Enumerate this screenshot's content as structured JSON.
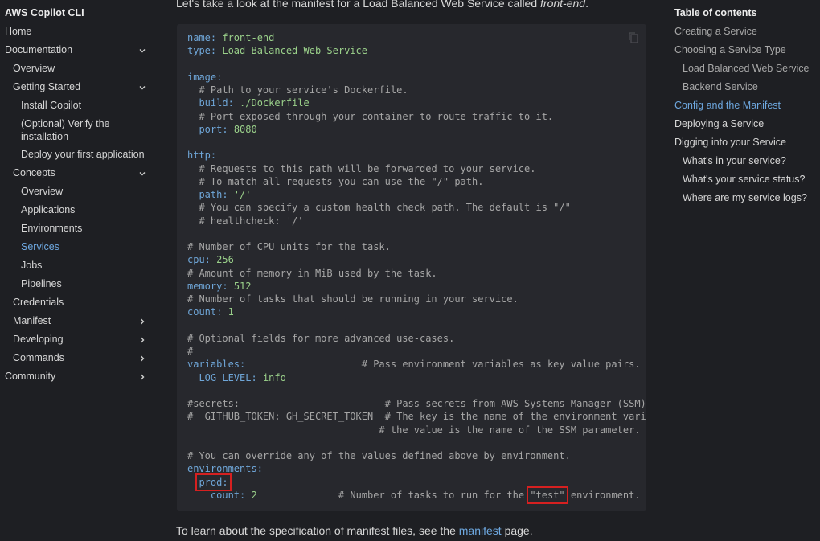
{
  "sidebar": {
    "site_title": "AWS Copilot CLI",
    "items": [
      {
        "label": "Home"
      },
      {
        "label": "Documentation"
      },
      {
        "label": "Overview"
      },
      {
        "label": "Getting Started"
      },
      {
        "label": "Install Copilot"
      },
      {
        "label": "(Optional) Verify the installation"
      },
      {
        "label": "Deploy your first application"
      },
      {
        "label": "Concepts"
      },
      {
        "label": "Overview"
      },
      {
        "label": "Applications"
      },
      {
        "label": "Environments"
      },
      {
        "label": "Services"
      },
      {
        "label": "Jobs"
      },
      {
        "label": "Pipelines"
      },
      {
        "label": "Credentials"
      },
      {
        "label": "Manifest"
      },
      {
        "label": "Developing"
      },
      {
        "label": "Commands"
      },
      {
        "label": "Community"
      }
    ]
  },
  "main": {
    "intro_prefix": "Let's take a look at the manifest for a Load Balanced Web Service called ",
    "intro_emph": "front-end",
    "intro_suffix": ".",
    "code": {
      "l1k": "name:",
      "l1v": "front-end",
      "l2k": "type:",
      "l2v": "Load Balanced Web Service",
      "image_k": "image:",
      "c_dockerfile": "# Path to your service's Dockerfile.",
      "build_k": "build:",
      "build_v": "./Dockerfile",
      "c_port": "# Port exposed through your container to route traffic to it.",
      "port_k": "port:",
      "port_v": "8080",
      "http_k": "http:",
      "c_http1": "# Requests to this path will be forwarded to your service.",
      "c_http2": "# To match all requests you can use the \"/\" path.",
      "path_k": "path:",
      "path_v": "'/'",
      "c_hc1": "# You can specify a custom health check path. The default is \"/\"",
      "c_hc2": "# healthcheck: '/'",
      "c_cpu": "# Number of CPU units for the task.",
      "cpu_k": "cpu:",
      "cpu_v": "256",
      "c_mem": "# Amount of memory in MiB used by the task.",
      "mem_k": "memory:",
      "mem_v": "512",
      "c_count": "# Number of tasks that should be running in your service.",
      "count_k": "count:",
      "count_v": "1",
      "c_opt": "# Optional fields for more advanced use-cases.",
      "c_hash": "#",
      "vars_k": "variables:",
      "c_vars": "# Pass environment variables as key value pairs.",
      "log_k": "LOG_LEVEL:",
      "log_v": "info",
      "c_secrets1a": "#secrets:",
      "c_secrets1b": "# Pass secrets from AWS Systems Manager (SSM) Pa",
      "c_secrets2a": "#  GITHUB_TOKEN: GH_SECRET_TOKEN",
      "c_secrets2b": "# The key is the name of the environment variabl",
      "c_secrets3": "# the value is the name of the SSM parameter.",
      "c_override": "# You can override any of the values defined above by environment.",
      "envs_k": "environments:",
      "prod_k": "prod:",
      "env_count_k": "count:",
      "env_count_v": "2",
      "c_env1": "# Number of tasks to run for the ",
      "c_env_test": "\"test\"",
      "c_env2": " environment."
    },
    "outro_prefix": "To learn about the specification of manifest files, see the ",
    "outro_link": "manifest",
    "outro_suffix": " page."
  },
  "toc": {
    "title": "Table of contents",
    "items": [
      {
        "label": "Creating a Service"
      },
      {
        "label": "Choosing a Service Type"
      },
      {
        "label": "Load Balanced Web Service"
      },
      {
        "label": "Backend Service"
      },
      {
        "label": "Config and the Manifest"
      },
      {
        "label": "Deploying a Service"
      },
      {
        "label": "Digging into your Service"
      },
      {
        "label": "What's in your service?"
      },
      {
        "label": "What's your service status?"
      },
      {
        "label": "Where are my service logs?"
      }
    ]
  },
  "colors": {
    "accent": "#6ea8e0",
    "background": "#1e1f23",
    "code_background": "#27282d",
    "highlight": "#d62020"
  },
  "icons": {
    "expand": "chevron-down-icon",
    "collapse": "chevron-right-icon",
    "copy": "copy-icon"
  }
}
